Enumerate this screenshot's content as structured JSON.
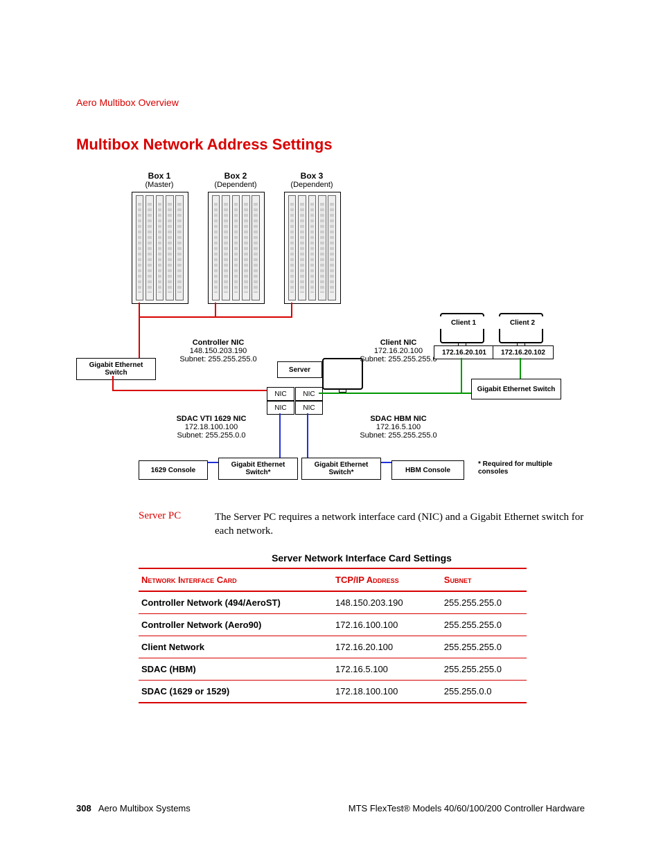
{
  "section_header": "Aero Multibox Overview",
  "main_title": "Multibox Network Address Settings",
  "boxes": {
    "box1": {
      "name": "Box 1",
      "role": "(Master)"
    },
    "box2": {
      "name": "Box 2",
      "role": "(Dependent)"
    },
    "box3": {
      "name": "Box 3",
      "role": "(Dependent)"
    }
  },
  "nics": {
    "controller": {
      "title": "Controller NIC",
      "ip": "148.150.203.190",
      "subnet": "Subnet: 255.255.255.0"
    },
    "client": {
      "title": "Client NIC",
      "ip": "172.16.20.100",
      "subnet": "Subnet: 255.255.255.0"
    },
    "sdac_vti": {
      "title": "SDAC VTI 1629 NIC",
      "ip": "172.18.100.100",
      "subnet": "Subnet: 255.255.0.0"
    },
    "sdac_hbm": {
      "title": "SDAC HBM NIC",
      "ip": "172.16.5.100",
      "subnet": "Subnet: 255.255.255.0"
    }
  },
  "clients": {
    "c1": {
      "label": "Client 1",
      "ip": "172.16.20.101"
    },
    "c2": {
      "label": "Client 2",
      "ip": "172.16.20.102"
    }
  },
  "labels": {
    "ge_switch": "Gigabit Ethernet Switch",
    "ge_switch_star": "Gigabit Ethernet Switch*",
    "server": "Server",
    "nic": "NIC",
    "console_1629": "1629 Console",
    "console_hbm": "HBM Console",
    "footnote": "* Required for multiple consoles"
  },
  "server_pc_label": "Server PC",
  "server_pc_text": "The Server PC requires a network interface card (NIC) and a Gigabit Ethernet switch for each network.",
  "table_title": "Server Network Interface Card Settings",
  "table_headers": {
    "c1": "Network Interface Card",
    "c2": "TCP/IP Address",
    "c3": "Subnet"
  },
  "table_rows": [
    {
      "name": "Controller Network (494/AeroST)",
      "ip": "148.150.203.190",
      "subnet": "255.255.255.0"
    },
    {
      "name": "Controller Network (Aero90)",
      "ip": "172.16.100.100",
      "subnet": "255.255.255.0"
    },
    {
      "name": "Client Network",
      "ip": "172.16.20.100",
      "subnet": "255.255.255.0"
    },
    {
      "name": "SDAC (HBM)",
      "ip": "172.16.5.100",
      "subnet": "255.255.255.0"
    },
    {
      "name": "SDAC (1629 or 1529)",
      "ip": "172.18.100.100",
      "subnet": "255.255.0.0"
    }
  ],
  "footer": {
    "page_number": "308",
    "left_text": "Aero Multibox Systems",
    "right_text": "MTS FlexTest® Models 40/60/100/200 Controller Hardware"
  },
  "chart_data": {
    "type": "diagram",
    "title": "Multibox Network Address Settings",
    "nodes": [
      {
        "id": "box1",
        "label": "Box 1 (Master)",
        "type": "controller"
      },
      {
        "id": "box2",
        "label": "Box 2 (Dependent)",
        "type": "controller"
      },
      {
        "id": "box3",
        "label": "Box 3 (Dependent)",
        "type": "controller"
      },
      {
        "id": "ge_switch_ctrl",
        "label": "Gigabit Ethernet Switch",
        "type": "switch",
        "network": "controller"
      },
      {
        "id": "server",
        "label": "Server",
        "type": "server",
        "nics": [
          {
            "name": "Controller NIC",
            "ip": "148.150.203.190",
            "subnet": "255.255.255.0"
          },
          {
            "name": "Client NIC",
            "ip": "172.16.20.100",
            "subnet": "255.255.255.0"
          },
          {
            "name": "SDAC VTI 1629 NIC",
            "ip": "172.18.100.100",
            "subnet": "255.255.0.0"
          },
          {
            "name": "SDAC HBM NIC",
            "ip": "172.16.5.100",
            "subnet": "255.255.255.0"
          }
        ]
      },
      {
        "id": "client1",
        "label": "Client 1",
        "ip": "172.16.20.101",
        "type": "client"
      },
      {
        "id": "client2",
        "label": "Client 2",
        "ip": "172.16.20.102",
        "type": "client"
      },
      {
        "id": "ge_switch_client",
        "label": "Gigabit Ethernet Switch",
        "type": "switch",
        "network": "client"
      },
      {
        "id": "ge_switch_1629",
        "label": "Gigabit Ethernet Switch*",
        "type": "switch",
        "network": "sdac_1629"
      },
      {
        "id": "ge_switch_hbm",
        "label": "Gigabit Ethernet Switch*",
        "type": "switch",
        "network": "sdac_hbm"
      },
      {
        "id": "console_1629",
        "label": "1629 Console",
        "type": "console"
      },
      {
        "id": "console_hbm",
        "label": "HBM Console",
        "type": "console"
      }
    ],
    "edges": [
      {
        "from": "box1",
        "to": "ge_switch_ctrl",
        "color": "red"
      },
      {
        "from": "box2",
        "to": "ge_switch_ctrl",
        "color": "red"
      },
      {
        "from": "box3",
        "to": "ge_switch_ctrl",
        "color": "red"
      },
      {
        "from": "ge_switch_ctrl",
        "to": "server",
        "via": "Controller NIC",
        "color": "red"
      },
      {
        "from": "server",
        "to": "ge_switch_client",
        "via": "Client NIC",
        "color": "green"
      },
      {
        "from": "ge_switch_client",
        "to": "client1",
        "color": "green"
      },
      {
        "from": "ge_switch_client",
        "to": "client2",
        "color": "green"
      },
      {
        "from": "server",
        "to": "ge_switch_1629",
        "via": "SDAC VTI 1629 NIC",
        "color": "blue"
      },
      {
        "from": "ge_switch_1629",
        "to": "console_1629",
        "color": "blue"
      },
      {
        "from": "server",
        "to": "ge_switch_hbm",
        "via": "SDAC HBM NIC",
        "color": "blue"
      },
      {
        "from": "ge_switch_hbm",
        "to": "console_hbm",
        "color": "blue"
      }
    ],
    "annotations": [
      "* Required for multiple consoles"
    ]
  }
}
